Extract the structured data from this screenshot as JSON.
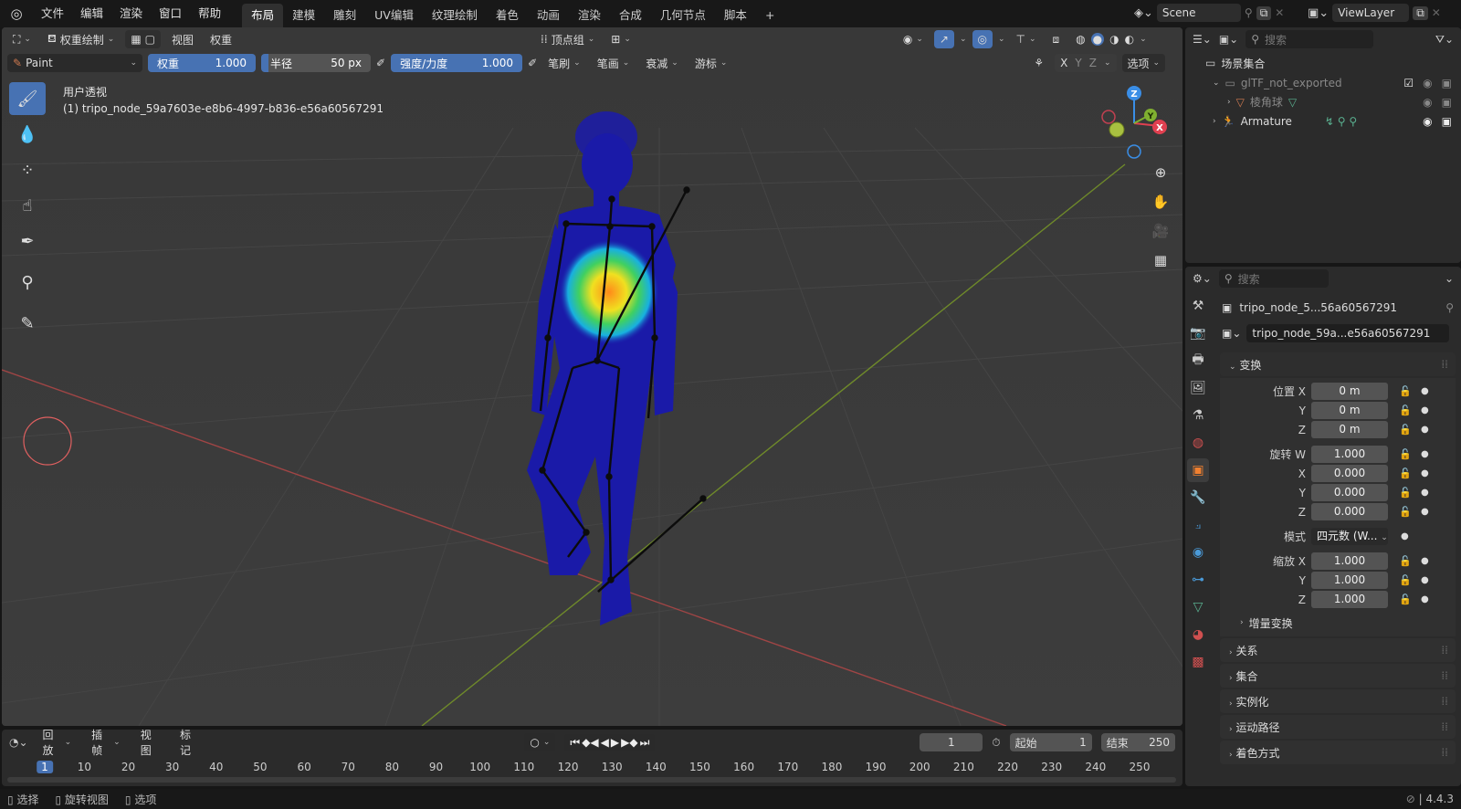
{
  "topbar": {
    "menus": [
      "文件",
      "编辑",
      "渲染",
      "窗口",
      "帮助"
    ],
    "workspaces": [
      "布局",
      "建模",
      "雕刻",
      "UV编辑",
      "纹理绘制",
      "着色",
      "动画",
      "渲染",
      "合成",
      "几何节点",
      "脚本"
    ],
    "active_workspace": "布局",
    "scene": "Scene",
    "view_layer": "ViewLayer"
  },
  "viewport_header": {
    "mode": "权重绘制",
    "menus": [
      "视图",
      "权重"
    ],
    "vertex_group": "顶点组"
  },
  "tool_settings": {
    "brush": "Paint",
    "weight_label": "权重",
    "weight_value": "1.000",
    "radius_label": "半径",
    "radius_value": "50 px",
    "strength_label": "强度/力度",
    "strength_value": "1.000",
    "menus": [
      "笔刷",
      "笔画",
      "衰减",
      "游标"
    ],
    "axes": [
      "X",
      "Y",
      "Z"
    ],
    "options": "选项"
  },
  "viewport_info": {
    "view_name": "用户透视",
    "object_name": "(1) tripo_node_59a7603e-e8b6-4997-b836-e56a60567291"
  },
  "gizmo": {
    "z": "Z",
    "y": "Y",
    "x": "X"
  },
  "outliner": {
    "search_placeholder": "搜索",
    "root": "场景集合",
    "items": [
      {
        "label": "glTF_not_exported",
        "dim": true
      },
      {
        "label": "棱角球",
        "dim": true
      },
      {
        "label": "Armature",
        "dim": false
      }
    ]
  },
  "properties": {
    "search_placeholder": "搜索",
    "object_short": "tripo_node_5...56a60567291",
    "data_short": "tripo_node_59a...e56a60567291",
    "transform_title": "变换",
    "location_label": "位置 X",
    "location": [
      "0 m",
      "0 m",
      "0 m"
    ],
    "rotation_label": "旋转 W",
    "rotation": [
      "1.000",
      "0.000",
      "0.000",
      "0.000"
    ],
    "mode_label": "模式",
    "mode_value": "四元数 (W...",
    "scale_label": "缩放 X",
    "scale": [
      "1.000",
      "1.000",
      "1.000"
    ],
    "axis_y": "Y",
    "axis_z": "Z",
    "axis_x": "X",
    "delta": "增量变换",
    "sections": [
      "关系",
      "集合",
      "实例化",
      "运动路径",
      "着色方式"
    ]
  },
  "timeline": {
    "menus": [
      "回放",
      "插帧",
      "视图",
      "标记"
    ],
    "current_frame": "1",
    "start_label": "起始",
    "start": "1",
    "end_label": "结束",
    "end": "250",
    "ticks": [
      "1",
      "10",
      "20",
      "30",
      "40",
      "50",
      "60",
      "70",
      "80",
      "90",
      "100",
      "110",
      "120",
      "130",
      "140",
      "150",
      "160",
      "170",
      "180",
      "190",
      "200",
      "210",
      "220",
      "230",
      "240",
      "250"
    ]
  },
  "statusbar": {
    "items": [
      "选择",
      "旋转视图",
      "选项"
    ],
    "version": "4.4.3"
  },
  "colors": {
    "accent": "#4772b3",
    "viewport": "#3a3a3a",
    "mesh": "#1a1aa8"
  }
}
